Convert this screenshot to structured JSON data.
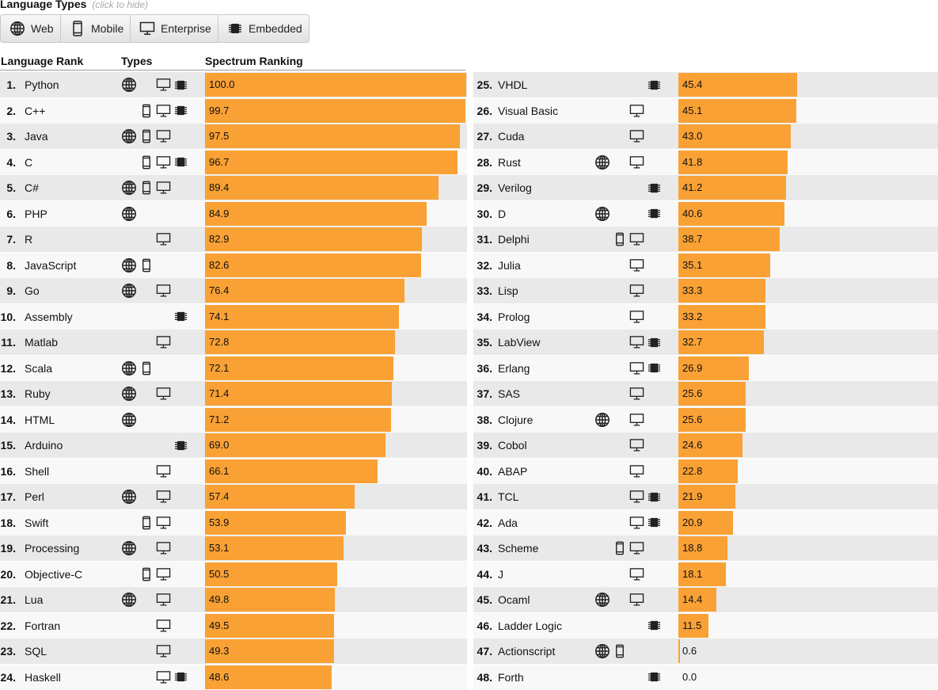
{
  "header": {
    "title": "Language Types",
    "hint": "(click to hide)"
  },
  "type_filters": [
    {
      "key": "web",
      "label": "Web",
      "icon": "globe-icon"
    },
    {
      "key": "mobile",
      "label": "Mobile",
      "icon": "mobile-phone-icon"
    },
    {
      "key": "enterprise",
      "label": "Enterprise",
      "icon": "monitor-icon"
    },
    {
      "key": "embedded",
      "label": "Embedded",
      "icon": "chip-icon"
    }
  ],
  "columns": {
    "rank": "Language Rank",
    "types": "Types",
    "ranking": "Spectrum Ranking"
  },
  "colors": {
    "bar": "#f9a135",
    "row_odd": "#e9e9e9",
    "row_even": "#f8f8f8"
  },
  "chart_data": {
    "type": "bar",
    "orientation": "horizontal",
    "xlim": [
      0,
      100
    ],
    "rows": [
      {
        "rank": "1.",
        "name": "Python",
        "value": "100.0",
        "types": [
          "web",
          "enterprise",
          "embedded"
        ]
      },
      {
        "rank": "2.",
        "name": "C++",
        "value": "99.7",
        "types": [
          "mobile",
          "enterprise",
          "embedded"
        ]
      },
      {
        "rank": "3.",
        "name": "Java",
        "value": "97.5",
        "types": [
          "web",
          "mobile",
          "enterprise"
        ]
      },
      {
        "rank": "4.",
        "name": "C",
        "value": "96.7",
        "types": [
          "mobile",
          "enterprise",
          "embedded"
        ]
      },
      {
        "rank": "5.",
        "name": "C#",
        "value": "89.4",
        "types": [
          "web",
          "mobile",
          "enterprise"
        ]
      },
      {
        "rank": "6.",
        "name": "PHP",
        "value": "84.9",
        "types": [
          "web"
        ]
      },
      {
        "rank": "7.",
        "name": "R",
        "value": "82.9",
        "types": [
          "enterprise"
        ]
      },
      {
        "rank": "8.",
        "name": "JavaScript",
        "value": "82.6",
        "types": [
          "web",
          "mobile"
        ]
      },
      {
        "rank": "9.",
        "name": "Go",
        "value": "76.4",
        "types": [
          "web",
          "enterprise"
        ]
      },
      {
        "rank": "10.",
        "name": "Assembly",
        "value": "74.1",
        "types": [
          "embedded"
        ]
      },
      {
        "rank": "11.",
        "name": "Matlab",
        "value": "72.8",
        "types": [
          "enterprise"
        ]
      },
      {
        "rank": "12.",
        "name": "Scala",
        "value": "72.1",
        "types": [
          "web",
          "mobile"
        ]
      },
      {
        "rank": "13.",
        "name": "Ruby",
        "value": "71.4",
        "types": [
          "web",
          "enterprise"
        ]
      },
      {
        "rank": "14.",
        "name": "HTML",
        "value": "71.2",
        "types": [
          "web"
        ]
      },
      {
        "rank": "15.",
        "name": "Arduino",
        "value": "69.0",
        "types": [
          "embedded"
        ]
      },
      {
        "rank": "16.",
        "name": "Shell",
        "value": "66.1",
        "types": [
          "enterprise"
        ]
      },
      {
        "rank": "17.",
        "name": "Perl",
        "value": "57.4",
        "types": [
          "web",
          "enterprise"
        ]
      },
      {
        "rank": "18.",
        "name": "Swift",
        "value": "53.9",
        "types": [
          "mobile",
          "enterprise"
        ]
      },
      {
        "rank": "19.",
        "name": "Processing",
        "value": "53.1",
        "types": [
          "web",
          "enterprise"
        ]
      },
      {
        "rank": "20.",
        "name": "Objective-C",
        "value": "50.5",
        "types": [
          "mobile",
          "enterprise"
        ]
      },
      {
        "rank": "21.",
        "name": "Lua",
        "value": "49.8",
        "types": [
          "web",
          "enterprise"
        ]
      },
      {
        "rank": "22.",
        "name": "Fortran",
        "value": "49.5",
        "types": [
          "enterprise"
        ]
      },
      {
        "rank": "23.",
        "name": "SQL",
        "value": "49.3",
        "types": [
          "enterprise"
        ]
      },
      {
        "rank": "24.",
        "name": "Haskell",
        "value": "48.6",
        "types": [
          "enterprise",
          "embedded"
        ]
      },
      {
        "rank": "25.",
        "name": "VHDL",
        "value": "45.4",
        "types": [
          "embedded"
        ]
      },
      {
        "rank": "26.",
        "name": "Visual Basic",
        "value": "45.1",
        "types": [
          "enterprise"
        ]
      },
      {
        "rank": "27.",
        "name": "Cuda",
        "value": "43.0",
        "types": [
          "enterprise"
        ]
      },
      {
        "rank": "28.",
        "name": "Rust",
        "value": "41.8",
        "types": [
          "web",
          "enterprise"
        ]
      },
      {
        "rank": "29.",
        "name": "Verilog",
        "value": "41.2",
        "types": [
          "embedded"
        ]
      },
      {
        "rank": "30.",
        "name": "D",
        "value": "40.6",
        "types": [
          "web",
          "embedded"
        ]
      },
      {
        "rank": "31.",
        "name": "Delphi",
        "value": "38.7",
        "types": [
          "mobile",
          "enterprise"
        ]
      },
      {
        "rank": "32.",
        "name": "Julia",
        "value": "35.1",
        "types": [
          "enterprise"
        ]
      },
      {
        "rank": "33.",
        "name": "Lisp",
        "value": "33.3",
        "types": [
          "enterprise"
        ]
      },
      {
        "rank": "34.",
        "name": "Prolog",
        "value": "33.2",
        "types": [
          "enterprise"
        ]
      },
      {
        "rank": "35.",
        "name": "LabView",
        "value": "32.7",
        "types": [
          "enterprise",
          "embedded"
        ]
      },
      {
        "rank": "36.",
        "name": "Erlang",
        "value": "26.9",
        "types": [
          "enterprise",
          "embedded"
        ]
      },
      {
        "rank": "37.",
        "name": "SAS",
        "value": "25.6",
        "types": [
          "enterprise"
        ]
      },
      {
        "rank": "38.",
        "name": "Clojure",
        "value": "25.6",
        "types": [
          "web",
          "enterprise"
        ]
      },
      {
        "rank": "39.",
        "name": "Cobol",
        "value": "24.6",
        "types": [
          "enterprise"
        ]
      },
      {
        "rank": "40.",
        "name": "ABAP",
        "value": "22.8",
        "types": [
          "enterprise"
        ]
      },
      {
        "rank": "41.",
        "name": "TCL",
        "value": "21.9",
        "types": [
          "enterprise",
          "embedded"
        ]
      },
      {
        "rank": "42.",
        "name": "Ada",
        "value": "20.9",
        "types": [
          "enterprise",
          "embedded"
        ]
      },
      {
        "rank": "43.",
        "name": "Scheme",
        "value": "18.8",
        "types": [
          "mobile",
          "enterprise"
        ]
      },
      {
        "rank": "44.",
        "name": "J",
        "value": "18.1",
        "types": [
          "enterprise"
        ]
      },
      {
        "rank": "45.",
        "name": "Ocaml",
        "value": "14.4",
        "types": [
          "web",
          "enterprise"
        ]
      },
      {
        "rank": "46.",
        "name": "Ladder Logic",
        "value": "11.5",
        "types": [
          "embedded"
        ]
      },
      {
        "rank": "47.",
        "name": "Actionscript",
        "value": "0.6",
        "types": [
          "web",
          "mobile"
        ]
      },
      {
        "rank": "48.",
        "name": "Forth",
        "value": "0.0",
        "types": [
          "embedded"
        ]
      }
    ]
  }
}
